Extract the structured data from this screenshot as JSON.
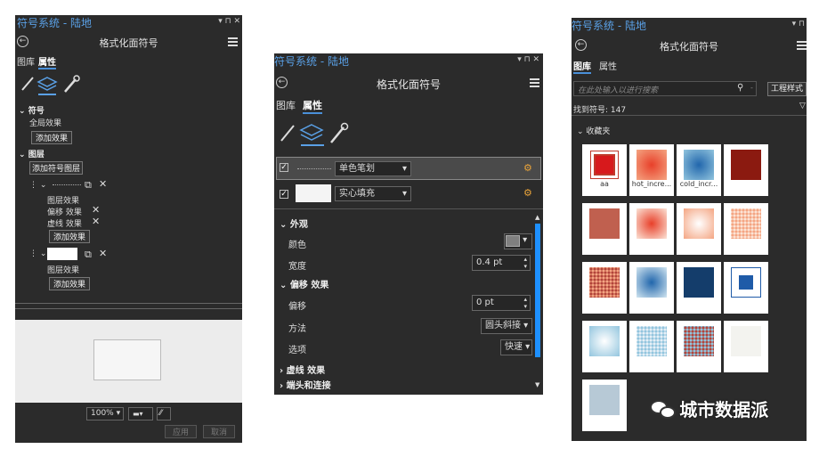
{
  "colors": {
    "panel_bg": "#2b2b2b",
    "accent": "#5aa0e6",
    "selection_blue": "#1e90ff"
  },
  "p1": {
    "window_title": "符号系统 - 陆地",
    "window_controls": "▾ ⊓ ✕",
    "header": "格式化面符号",
    "tabs": [
      "图库",
      "属性"
    ],
    "symbol_section": "符号",
    "global_effects": "全局效果",
    "add_effect": "添加效果",
    "layers_section": "图层",
    "add_symbol_layer": "添加符号图层",
    "layer_effects": "图层效果",
    "offset_effect": "偏移 效果",
    "dash_effect": "虚线 效果",
    "add_effect_2": "添加效果",
    "layer_effects_2": "图层效果",
    "add_effect_3": "添加效果",
    "zoom": "100%",
    "apply": "应用",
    "cancel": "取消"
  },
  "p2": {
    "window_title": "符号系统 - 陆地",
    "window_controls": "▾ ⊓ ✕",
    "header": "格式化面符号",
    "tabs": [
      "图库",
      "属性"
    ],
    "layer1_name": "单色笔划",
    "layer2_name": "实心填充",
    "appearance": "外观",
    "color_label": "颜色",
    "width_label": "宽度",
    "width_value": "0.4 pt",
    "offset_effect": "偏移 效果",
    "offset_label": "偏移",
    "offset_value": "0 pt",
    "method_label": "方法",
    "method_value": "圆头斜接",
    "options_label": "选项",
    "options_value": "快速",
    "dash_effect": "虚线 效果",
    "caps_joins": "端头和连接"
  },
  "p3": {
    "window_title": "符号系统 - 陆地",
    "window_controls": "▾ ⊓",
    "header": "格式化面符号",
    "tabs": [
      "图库",
      "属性"
    ],
    "search_placeholder": "在此处输入以进行搜索",
    "style_button": "工程样式",
    "found_count": "找到符号: 147",
    "favorites": "收藏夹",
    "tiles": [
      {
        "label": "aa",
        "fill": "#d7191c",
        "border": "#c0392b"
      },
      {
        "label": "hot_incre...",
        "fill": "radial-gradient(#e8402a,#f4a582)",
        "border": ""
      },
      {
        "label": "cold_incr...",
        "fill": "radial-gradient(#2166ac,#92c5de)",
        "border": ""
      },
      {
        "label": "",
        "fill": "#8b1a10",
        "border": ""
      },
      {
        "label": "",
        "fill": "#c0604f",
        "border": ""
      },
      {
        "label": "",
        "fill": "radial-gradient(#e8402a,#fbe3d6)",
        "border": ""
      },
      {
        "label": "",
        "fill": "radial-gradient(#fff,#f4a582)",
        "border": ""
      },
      {
        "label": "",
        "fill": "radial-gradient(circle,#f4a582 1.5px,#fce4d6 1.5px)",
        "border": ""
      },
      {
        "label": "",
        "fill": "radial-gradient(circle,#b2443a 1.5px,#f4a582 1.5px)",
        "border": ""
      },
      {
        "label": "",
        "fill": "radial-gradient(#2166ac,#d1e5f0)",
        "border": ""
      },
      {
        "label": "",
        "fill": "#143d6b",
        "border": ""
      },
      {
        "label": "",
        "fill": "#1f5ba8",
        "border": "#1f5ba8"
      },
      {
        "label": "",
        "fill": "radial-gradient(#fff,#92c5de)",
        "border": ""
      },
      {
        "label": "",
        "fill": "radial-gradient(circle,#92c5de 1.5px,#e6f0f7 1.5px)",
        "border": ""
      },
      {
        "label": "",
        "fill": "radial-gradient(circle,#b2443a 1.5px,#92c5de 1.5px)",
        "border": ""
      },
      {
        "label": "",
        "fill": "#f3f3ef",
        "border": ""
      },
      {
        "label": "",
        "fill": "#b7c9d6",
        "border": ""
      }
    ]
  },
  "watermark": "城市数据派"
}
